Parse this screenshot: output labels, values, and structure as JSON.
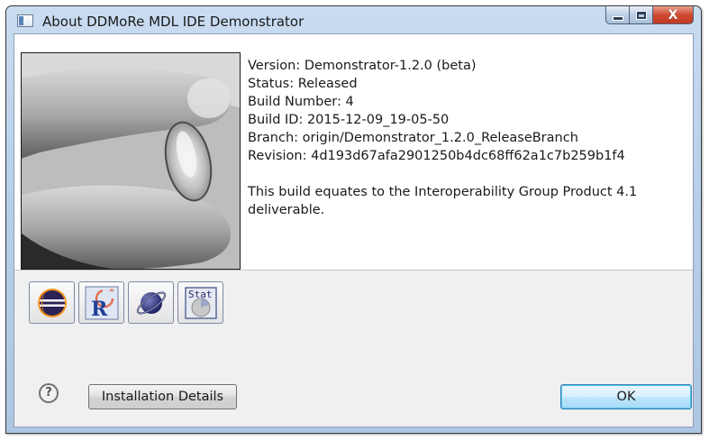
{
  "window": {
    "title": "About DDMoRe MDL IDE Demonstrator",
    "icon": "app-window-icon"
  },
  "caption_buttons": {
    "minimize_icon": "minimize-icon",
    "maximize_icon": "maximize-icon",
    "close_icon": "close-icon",
    "close_glyph": "X"
  },
  "info": {
    "version": "Version: Demonstrator-1.2.0 (beta)",
    "status": "Status: Released",
    "build_number": "Build Number: 4",
    "build_id": "Build ID: 2015-12-09_19-05-50",
    "branch": "Branch: origin/Demonstrator_1.2.0_ReleaseBranch",
    "revision": "Revision: 4d193d67afa2901250b4dc68ff62a1c7b259b1f4",
    "description": "This build equates to the Interoperability Group Product 4.1 deliverable."
  },
  "features": [
    {
      "icon": "eclipse-icon"
    },
    {
      "icon": "r-language-icon"
    },
    {
      "icon": "planet-icon"
    },
    {
      "icon": "stat-icon",
      "label": "Stat"
    }
  ],
  "footer": {
    "help_glyph": "?",
    "installation_details_label": "Installation Details",
    "ok_label": "OK"
  },
  "colors": {
    "titlebar": "#b9d0ea",
    "close_button": "#c23b22",
    "ok_border": "#3c7fb1",
    "client_bg": "#f0f0f0"
  }
}
